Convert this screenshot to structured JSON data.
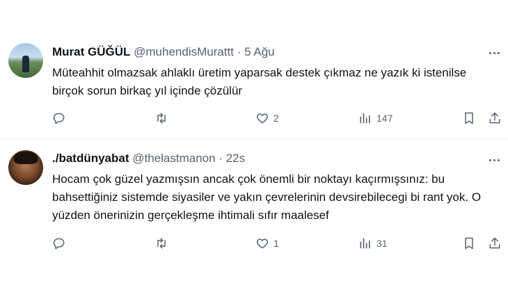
{
  "tweets": [
    {
      "name": "Murat GÜĞÜL",
      "handle": "@muhendisMurattt",
      "separator": "·",
      "time": "5 Ağu",
      "text": "Müteahhit olmazsak ahlaklı üretim yaparsak destek çıkmaz ne yazık ki istenilse birçok sorun birkaç yıl içinde çözülür",
      "likes": "2",
      "views": "147",
      "retweets": "",
      "replies": ""
    },
    {
      "name": "./batdünyabat",
      "handle": "@thelastmanon",
      "separator": "·",
      "time": "22s",
      "text": "Hocam çok güzel yazmışsın ancak çok önemli bir noktayı kaçırmışsınız: bu bahsettiğiniz sistemde siyasiler ve yakın çevrelerinin devsirebilecegi bi rant yok. O yüzden önerinizin gerçekleşme ihtimali sıfır maalesef",
      "likes": "1",
      "views": "31",
      "retweets": "",
      "replies": ""
    }
  ],
  "icons": [
    "reply-icon",
    "retweet-icon",
    "like-icon",
    "views-icon",
    "bookmark-icon",
    "share-icon",
    "more-icon"
  ],
  "colors": {
    "text": "#0f1419",
    "muted": "#536471",
    "divider": "#eff3f4"
  }
}
